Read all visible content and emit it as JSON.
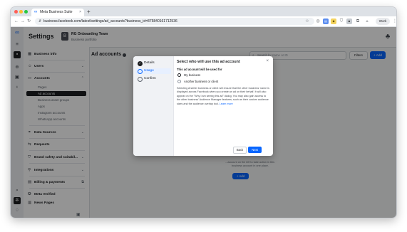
{
  "browser": {
    "tab_title": "Meta Business Suite",
    "new_tab": "+",
    "url": "business.facebook.com/latest/settings/ad_accounts?business_id=875840161712536",
    "profile_pill": "Work"
  },
  "app": {
    "page_title": "Settings",
    "business_name": "RG Onboarding Team",
    "business_type": "Business portfolio"
  },
  "sidenav": {
    "business_info": "Business info",
    "users": "Users",
    "accounts": "Accounts",
    "accounts_items": [
      "Pages",
      "Ad accounts",
      "Business asset groups",
      "Apps",
      "Instagram accounts",
      "WhatsApp accounts"
    ],
    "data_sources": "Data Sources",
    "requests": "Requests",
    "brand_safety": "Brand safety and suitabil...",
    "integrations": "Integrations",
    "billing": "Billing & payments",
    "meta_verified": "Meta Verified",
    "news_pages": "News Pages"
  },
  "content": {
    "title": "Ad accounts",
    "search_placeholder": "Search by name or ID",
    "filters": "Filters",
    "add": "+ Add",
    "empty_line1": "...account on the left to take action in this",
    "empty_line2": "business account in one place.",
    "empty_add": "+ Add"
  },
  "modal": {
    "steps": [
      "Details",
      "Usage",
      "Confirm"
    ],
    "title": "Select who will use this ad account",
    "question": "This ad account will be used for",
    "options": [
      "My business",
      "Another business or client"
    ],
    "description": "Selecting Another business or client will ensure that the other business' name is displayed across Facebook when you create an ad on their behalf. It will also appear on the \"Why I am seeing this ad\" dialog. You may also gain access to the other business' Audience Manager features, such as their custom audience sizes and the audience overlap tool.",
    "learn_more": "Learn more",
    "back": "Back",
    "next": "Next"
  },
  "colors": {
    "primary": "#0866ff",
    "active_nav": "#1c1e21",
    "overlay": "#000000"
  }
}
